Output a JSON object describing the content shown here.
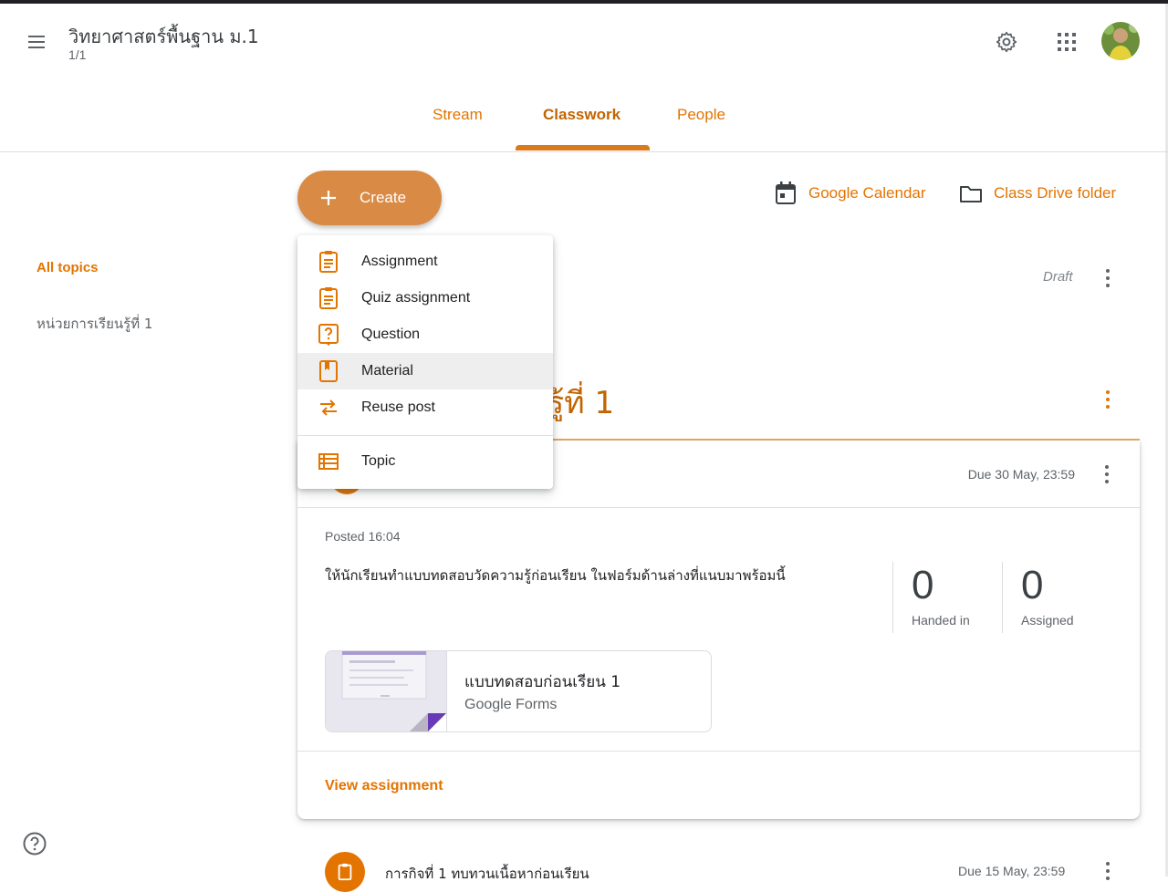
{
  "header": {
    "class_title": "วิทยาศาสตร์พื้นฐาน ม.1",
    "class_section": "1/1"
  },
  "tabs": [
    {
      "label": "Stream"
    },
    {
      "label": "Classwork"
    },
    {
      "label": "People"
    }
  ],
  "toolbar": {
    "create_label": "Create",
    "calendar_label": "Google Calendar",
    "drive_label": "Class Drive folder"
  },
  "create_menu": {
    "items": [
      {
        "label": "Assignment",
        "icon": "assignment-icon"
      },
      {
        "label": "Quiz assignment",
        "icon": "quiz-assignment-icon"
      },
      {
        "label": "Question",
        "icon": "question-icon"
      },
      {
        "label": "Material",
        "icon": "material-icon"
      },
      {
        "label": "Reuse post",
        "icon": "reuse-post-icon"
      },
      {
        "label": "Topic",
        "icon": "topic-icon"
      }
    ]
  },
  "sidebar": {
    "all_topics": "All topics",
    "topic_1": "หน่วยการเรียนรู้ที่ 1"
  },
  "draft_label": "Draft",
  "topic_heading": "รู้ที่ 1",
  "assignment": {
    "due": "Due 30 May, 23:59",
    "posted": "Posted 16:04",
    "description": "ให้นักเรียนทำแบบทดสอบวัดความรู้ก่อนเรียน ในฟอร์มด้านล่างที่แนบมาพร้อมนี้",
    "handed_in_count": "0",
    "handed_in_label": "Handed in",
    "assigned_count": "0",
    "assigned_label": "Assigned",
    "attachment_title": "แบบทดสอบก่อนเรียน 1",
    "attachment_type": "Google Forms",
    "view_label": "View assignment"
  },
  "next_item": {
    "title": "การกิจที่ 1 ทบทวนเนื้อหาก่อนเรียน",
    "due": "Due 15 May, 23:59"
  },
  "colors": {
    "accent": "#e37400",
    "create_bg": "#d98a45"
  }
}
